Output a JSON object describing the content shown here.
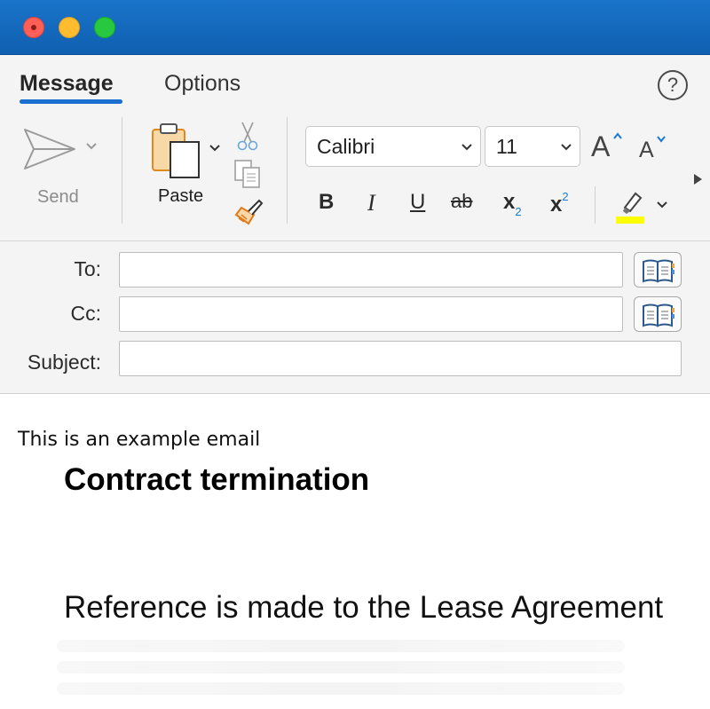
{
  "window": {
    "controls": [
      "close",
      "minimize",
      "maximize"
    ]
  },
  "ribbon": {
    "tabs": [
      {
        "label": "Message",
        "active": true
      },
      {
        "label": "Options",
        "active": false
      }
    ],
    "help_label": "?",
    "send_label": "Send",
    "paste_label": "Paste",
    "font_family": "Calibri",
    "font_size": "11",
    "format": {
      "bold": "B",
      "italic": "I",
      "underline": "U",
      "strikethrough": "ab",
      "subscript": "x",
      "subscript_small": "2",
      "superscript": "x",
      "superscript_small": "2"
    },
    "highlight_color": "#ffff00",
    "accent_color": "#1a6fd0"
  },
  "headers": {
    "to_label": "To:",
    "cc_label": "Cc:",
    "subject_label": "Subject:",
    "to_value": "",
    "cc_value": "",
    "subject_value": ""
  },
  "body": {
    "intro": "This is an example email",
    "heading": "Contract termination",
    "paragraph": "Reference is made to the Lease Agreement"
  }
}
